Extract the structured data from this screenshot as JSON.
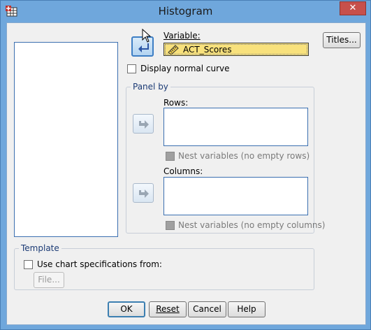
{
  "window": {
    "title": "Histogram",
    "close_glyph": "✕"
  },
  "variable": {
    "label": "Variable:",
    "value": "ACT_Scores",
    "icon": "ruler-icon"
  },
  "display_normal_curve": {
    "label": "Display normal curve",
    "checked": false
  },
  "panel_by": {
    "title": "Panel by",
    "rows_label": "Rows:",
    "nest_rows_label": "Nest variables (no empty rows)",
    "columns_label": "Columns:",
    "nest_columns_label": "Nest variables (no empty columns)"
  },
  "template": {
    "title": "Template",
    "use_chart_spec_label": "Use chart specifications from:",
    "file_button": "File..."
  },
  "buttons": {
    "titles": "Titles...",
    "ok": "OK",
    "reset": "Reset",
    "cancel": "Cancel",
    "help": "Help"
  },
  "colors": {
    "title_bar": "#6fa7dc",
    "variable_highlight": "#f8e17c",
    "close_button": "#c7504b",
    "group_title": "#1c3b75"
  }
}
